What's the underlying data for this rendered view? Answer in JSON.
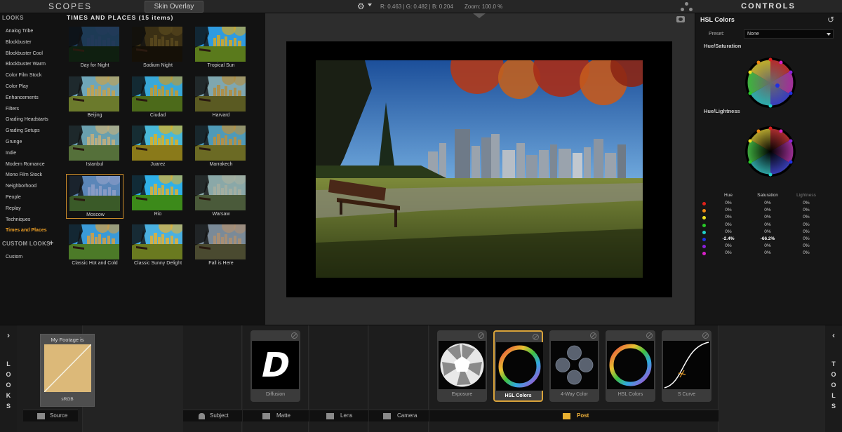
{
  "topbar": {
    "scopes_title": "SCOPES",
    "skin_overlay_label": "Skin Overlay",
    "readout": "R: 0.463 | G: 0.482 | B: 0.204",
    "zoom": "Zoom: 100.0 %",
    "controls_title": "CONTROLS"
  },
  "looks": {
    "header": "LOOKS",
    "categories": [
      {
        "label": "Analog Tribe",
        "active": false
      },
      {
        "label": "Blockbuster",
        "active": false
      },
      {
        "label": "Blockbuster Cool",
        "active": false
      },
      {
        "label": "Blockbuster Warm",
        "active": false
      },
      {
        "label": "Color Film Stock",
        "active": false
      },
      {
        "label": "Color Play",
        "active": false
      },
      {
        "label": "Enhancements",
        "active": false
      },
      {
        "label": "Filters",
        "active": false
      },
      {
        "label": "Grading Headstarts",
        "active": false
      },
      {
        "label": "Grading Setups",
        "active": false
      },
      {
        "label": "Grunge",
        "active": false
      },
      {
        "label": "Indie",
        "active": false
      },
      {
        "label": "Modern Romance",
        "active": false
      },
      {
        "label": "Mono Film Stock",
        "active": false
      },
      {
        "label": "Neighborhood",
        "active": false
      },
      {
        "label": "People",
        "active": false
      },
      {
        "label": "Replay",
        "active": false
      },
      {
        "label": "Techniques",
        "active": false
      },
      {
        "label": "Times and Places",
        "active": true
      }
    ],
    "custom_header": "CUSTOM LOOKS",
    "custom_item": "Custom",
    "grid_title": "TIMES AND PLACES (15 items)",
    "items": [
      {
        "label": "Day for Night",
        "sky": "#1d3a55",
        "ground": "#0f1f10",
        "tint": "#243a5a"
      },
      {
        "label": "Sodium Night",
        "sky": "#3a2f14",
        "ground": "#151007",
        "tint": "#5a4a1e"
      },
      {
        "label": "Tropical Sun",
        "sky": "#2f9be0",
        "ground": "#5a7a1c",
        "tint": "#d9a820"
      },
      {
        "label": "Beijing",
        "sky": "#6fa6b8",
        "ground": "#6b7a2c",
        "tint": "#c8a24a"
      },
      {
        "label": "Ciudad",
        "sky": "#38a8d8",
        "ground": "#4c6a1a",
        "tint": "#c79a2c"
      },
      {
        "label": "Harvard",
        "sky": "#7fa7b0",
        "ground": "#5a5a22",
        "tint": "#b48c3c"
      },
      {
        "label": "Istanbul",
        "sky": "#6aa0ae",
        "ground": "#55703a",
        "tint": "#c8b07a"
      },
      {
        "label": "Juarez",
        "sky": "#49b8d8",
        "ground": "#8a7a1a",
        "tint": "#e0b020"
      },
      {
        "label": "Marrakech",
        "sky": "#4f9ab8",
        "ground": "#6b6a24",
        "tint": "#c0903a"
      },
      {
        "label": "Moscow",
        "sky": "#5b86b8",
        "ground": "#3a5a28",
        "tint": "#8f9fc8"
      },
      {
        "label": "Rio",
        "sky": "#2fb0e8",
        "ground": "#3c8a1a",
        "tint": "#e0b030"
      },
      {
        "label": "Warsaw",
        "sky": "#8aa8a8",
        "ground": "#4a5a3a",
        "tint": "#a8b0a0"
      },
      {
        "label": "Classic Hot and Cold",
        "sky": "#3a9ad8",
        "ground": "#4c7a28",
        "tint": "#d8a040"
      },
      {
        "label": "Classic Sunny Delight",
        "sky": "#4ab0e0",
        "ground": "#6a7a20",
        "tint": "#e8b030"
      },
      {
        "label": "Fall is Here",
        "sky": "#7a8a98",
        "ground": "#4a4a30",
        "tint": "#b09070"
      }
    ],
    "selected_index": 9
  },
  "controls": {
    "title": "HSL Colors",
    "preset_label": "Preset:",
    "preset_value": "None",
    "wheel1_label": "Hue/Saturation",
    "wheel2_label": "Hue/Lightness",
    "table_headers": [
      "Hue",
      "Saturation",
      "Lightness"
    ],
    "rows": [
      {
        "color": "#e0201a",
        "hue": "0%",
        "sat": "0%",
        "light": "0%",
        "bold": false
      },
      {
        "color": "#f08a12",
        "hue": "0%",
        "sat": "0%",
        "light": "0%",
        "bold": false
      },
      {
        "color": "#f0e020",
        "hue": "0%",
        "sat": "0%",
        "light": "0%",
        "bold": false
      },
      {
        "color": "#28c828",
        "hue": "0%",
        "sat": "0%",
        "light": "0%",
        "bold": false
      },
      {
        "color": "#20d0c8",
        "hue": "0%",
        "sat": "0%",
        "light": "0%",
        "bold": false
      },
      {
        "color": "#2030e0",
        "hue": "-2.4%",
        "sat": "-66.2%",
        "light": "0%",
        "bold": true
      },
      {
        "color": "#8a20d8",
        "hue": "0%",
        "sat": "0%",
        "light": "0%",
        "bold": false
      },
      {
        "color": "#d820c8",
        "hue": "0%",
        "sat": "0%",
        "light": "0%",
        "bold": false
      }
    ]
  },
  "pipeline": {
    "looks_tab_letters": [
      "L",
      "O",
      "O",
      "K",
      "S"
    ],
    "tools_tab_letters": [
      "T",
      "O",
      "O",
      "L",
      "S"
    ],
    "source": {
      "title": "My Footage is",
      "subtitle": "sRGB",
      "tab_label": "Source"
    },
    "stages": {
      "subject": "Subject",
      "matte": "Matte",
      "lens": "Lens",
      "camera": "Camera",
      "post": "Post"
    },
    "lens_tool": {
      "label": "Diffusion",
      "glyph": "D"
    },
    "post_tools": [
      {
        "label": "Exposure",
        "kind": "aperture",
        "selected": false
      },
      {
        "label": "HSL Colors",
        "kind": "ring",
        "selected": true
      },
      {
        "label": "4-Way Color",
        "kind": "fourway",
        "selected": false
      },
      {
        "label": "HSL Colors",
        "kind": "ring",
        "selected": false
      },
      {
        "label": "S Curve",
        "kind": "curve",
        "selected": false
      }
    ]
  },
  "colors": {
    "accent_orange": "#f0a126",
    "selected_border": "#d9a33a"
  }
}
